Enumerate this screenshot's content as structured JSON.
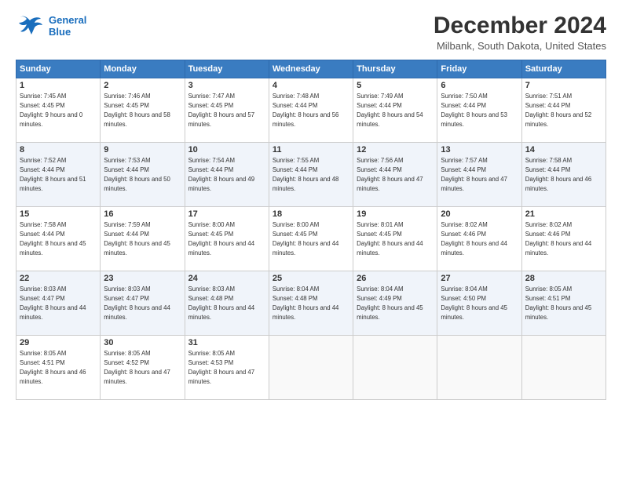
{
  "header": {
    "logo_line1": "General",
    "logo_line2": "Blue",
    "title": "December 2024",
    "subtitle": "Milbank, South Dakota, United States"
  },
  "days": [
    "Sunday",
    "Monday",
    "Tuesday",
    "Wednesday",
    "Thursday",
    "Friday",
    "Saturday"
  ],
  "weeks": [
    [
      {
        "num": "1",
        "sunrise": "7:45 AM",
        "sunset": "4:45 PM",
        "daylight": "9 hours and 0 minutes."
      },
      {
        "num": "2",
        "sunrise": "7:46 AM",
        "sunset": "4:45 PM",
        "daylight": "8 hours and 58 minutes."
      },
      {
        "num": "3",
        "sunrise": "7:47 AM",
        "sunset": "4:45 PM",
        "daylight": "8 hours and 57 minutes."
      },
      {
        "num": "4",
        "sunrise": "7:48 AM",
        "sunset": "4:44 PM",
        "daylight": "8 hours and 56 minutes."
      },
      {
        "num": "5",
        "sunrise": "7:49 AM",
        "sunset": "4:44 PM",
        "daylight": "8 hours and 54 minutes."
      },
      {
        "num": "6",
        "sunrise": "7:50 AM",
        "sunset": "4:44 PM",
        "daylight": "8 hours and 53 minutes."
      },
      {
        "num": "7",
        "sunrise": "7:51 AM",
        "sunset": "4:44 PM",
        "daylight": "8 hours and 52 minutes."
      }
    ],
    [
      {
        "num": "8",
        "sunrise": "7:52 AM",
        "sunset": "4:44 PM",
        "daylight": "8 hours and 51 minutes."
      },
      {
        "num": "9",
        "sunrise": "7:53 AM",
        "sunset": "4:44 PM",
        "daylight": "8 hours and 50 minutes."
      },
      {
        "num": "10",
        "sunrise": "7:54 AM",
        "sunset": "4:44 PM",
        "daylight": "8 hours and 49 minutes."
      },
      {
        "num": "11",
        "sunrise": "7:55 AM",
        "sunset": "4:44 PM",
        "daylight": "8 hours and 48 minutes."
      },
      {
        "num": "12",
        "sunrise": "7:56 AM",
        "sunset": "4:44 PM",
        "daylight": "8 hours and 47 minutes."
      },
      {
        "num": "13",
        "sunrise": "7:57 AM",
        "sunset": "4:44 PM",
        "daylight": "8 hours and 47 minutes."
      },
      {
        "num": "14",
        "sunrise": "7:58 AM",
        "sunset": "4:44 PM",
        "daylight": "8 hours and 46 minutes."
      }
    ],
    [
      {
        "num": "15",
        "sunrise": "7:58 AM",
        "sunset": "4:44 PM",
        "daylight": "8 hours and 45 minutes."
      },
      {
        "num": "16",
        "sunrise": "7:59 AM",
        "sunset": "4:44 PM",
        "daylight": "8 hours and 45 minutes."
      },
      {
        "num": "17",
        "sunrise": "8:00 AM",
        "sunset": "4:45 PM",
        "daylight": "8 hours and 44 minutes."
      },
      {
        "num": "18",
        "sunrise": "8:00 AM",
        "sunset": "4:45 PM",
        "daylight": "8 hours and 44 minutes."
      },
      {
        "num": "19",
        "sunrise": "8:01 AM",
        "sunset": "4:45 PM",
        "daylight": "8 hours and 44 minutes."
      },
      {
        "num": "20",
        "sunrise": "8:02 AM",
        "sunset": "4:46 PM",
        "daylight": "8 hours and 44 minutes."
      },
      {
        "num": "21",
        "sunrise": "8:02 AM",
        "sunset": "4:46 PM",
        "daylight": "8 hours and 44 minutes."
      }
    ],
    [
      {
        "num": "22",
        "sunrise": "8:03 AM",
        "sunset": "4:47 PM",
        "daylight": "8 hours and 44 minutes."
      },
      {
        "num": "23",
        "sunrise": "8:03 AM",
        "sunset": "4:47 PM",
        "daylight": "8 hours and 44 minutes."
      },
      {
        "num": "24",
        "sunrise": "8:03 AM",
        "sunset": "4:48 PM",
        "daylight": "8 hours and 44 minutes."
      },
      {
        "num": "25",
        "sunrise": "8:04 AM",
        "sunset": "4:48 PM",
        "daylight": "8 hours and 44 minutes."
      },
      {
        "num": "26",
        "sunrise": "8:04 AM",
        "sunset": "4:49 PM",
        "daylight": "8 hours and 45 minutes."
      },
      {
        "num": "27",
        "sunrise": "8:04 AM",
        "sunset": "4:50 PM",
        "daylight": "8 hours and 45 minutes."
      },
      {
        "num": "28",
        "sunrise": "8:05 AM",
        "sunset": "4:51 PM",
        "daylight": "8 hours and 45 minutes."
      }
    ],
    [
      {
        "num": "29",
        "sunrise": "8:05 AM",
        "sunset": "4:51 PM",
        "daylight": "8 hours and 46 minutes."
      },
      {
        "num": "30",
        "sunrise": "8:05 AM",
        "sunset": "4:52 PM",
        "daylight": "8 hours and 47 minutes."
      },
      {
        "num": "31",
        "sunrise": "8:05 AM",
        "sunset": "4:53 PM",
        "daylight": "8 hours and 47 minutes."
      },
      null,
      null,
      null,
      null
    ]
  ],
  "labels": {
    "sunrise": "Sunrise:",
    "sunset": "Sunset:",
    "daylight": "Daylight:"
  }
}
